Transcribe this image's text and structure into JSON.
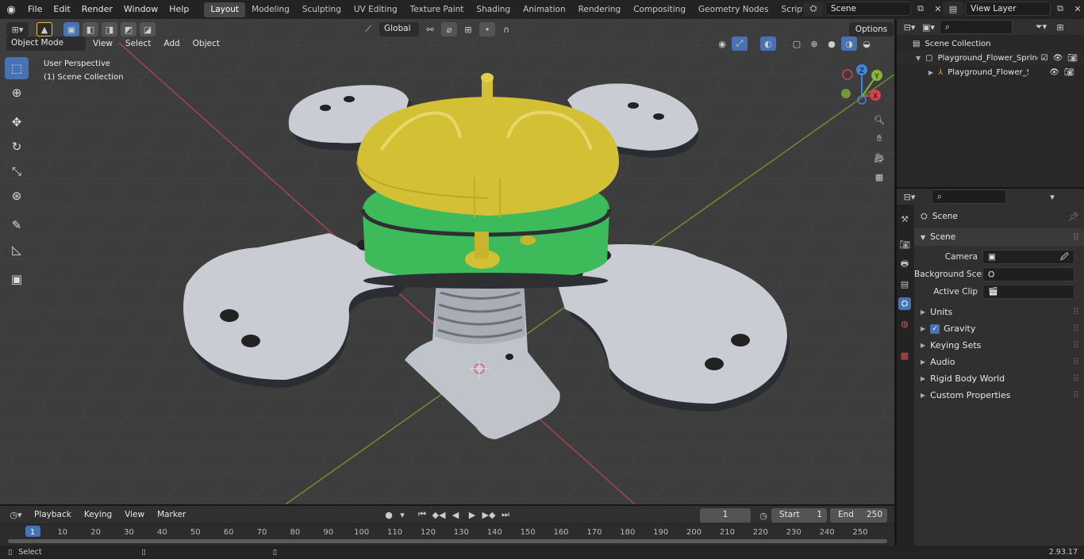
{
  "topbar": {
    "menus": [
      "File",
      "Edit",
      "Render",
      "Window",
      "Help"
    ],
    "workspaces": [
      "Layout",
      "Modeling",
      "Sculpting",
      "UV Editing",
      "Texture Paint",
      "Shading",
      "Animation",
      "Rendering",
      "Compositing",
      "Geometry Nodes",
      "Scripting"
    ],
    "active_workspace": "Layout",
    "scene": "Scene",
    "view_layer": "View Layer"
  },
  "viewport": {
    "transform_orientation": "Global",
    "options_label": "Options",
    "mode": "Object Mode",
    "menus": [
      "View",
      "Select",
      "Add",
      "Object"
    ],
    "overlay_line1": "User Perspective",
    "overlay_line2": "(1) Scene Collection",
    "gizmo_axes": {
      "x": "X",
      "y": "Y",
      "z": "Z"
    }
  },
  "outliner": {
    "root": "Scene Collection",
    "items": [
      {
        "label": "Playground_Flower_Springer_"
      },
      {
        "label": "Playground_Flower_Sprir"
      }
    ]
  },
  "properties": {
    "header": "Scene",
    "panel": "Scene",
    "fields": [
      {
        "label": "Camera",
        "value": ""
      },
      {
        "label": "Background Scene",
        "value": ""
      },
      {
        "label": "Active Clip",
        "value": ""
      }
    ],
    "sections": [
      "Units",
      "Gravity",
      "Keying Sets",
      "Audio",
      "Rigid Body World",
      "Custom Properties"
    ]
  },
  "timeline": {
    "menus": [
      "Playback",
      "Keying",
      "View",
      "Marker"
    ],
    "current_frame": "1",
    "start_label": "Start",
    "start": "1",
    "end_label": "End",
    "end": "250",
    "ticks": [
      "1",
      "10",
      "20",
      "30",
      "40",
      "50",
      "60",
      "70",
      "80",
      "90",
      "100",
      "110",
      "120",
      "130",
      "140",
      "150",
      "160",
      "170",
      "180",
      "190",
      "200",
      "210",
      "220",
      "230",
      "240",
      "250"
    ]
  },
  "statusbar": {
    "left": "Select",
    "version": "2.93.17"
  },
  "colors": {
    "accent": "#4772b3",
    "viewport_bg": "#3d3d3d",
    "panel_bg": "#303030",
    "axis_x": "#d6404f",
    "axis_y": "#86b53a",
    "axis_z": "#3f86d6",
    "yellow_mesh": "#d3c034",
    "green_mesh": "#3dbb5a",
    "grey_mesh": "#c9cdd3"
  }
}
